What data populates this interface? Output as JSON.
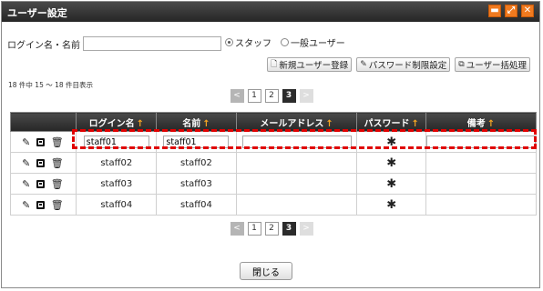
{
  "window": {
    "title": "ユーザー設定"
  },
  "search": {
    "label": "ログイン名・名前",
    "value": "",
    "placeholder": ""
  },
  "radio": {
    "staff_label": "スタッフ",
    "general_label": "一般ユーザー",
    "selected": "staff"
  },
  "actions": {
    "new_user": "新規ユーザー登録",
    "password_limit": "パスワード制限設定",
    "bulk": "ユーザー括処理"
  },
  "count_text": "18 件中 15 ～ 18 件目表示",
  "pager": {
    "pages": [
      "1",
      "2",
      "3"
    ],
    "current": "3"
  },
  "table": {
    "headers": [
      "ログイン名",
      "名前",
      "メールアドレス",
      "パスワード",
      "備考"
    ],
    "sort_arrow": "↑",
    "rows": [
      {
        "login": "staff01",
        "name": "staff01",
        "email": "",
        "note": "",
        "editing": true
      },
      {
        "login": "staff02",
        "name": "staff02",
        "email": "",
        "note": ""
      },
      {
        "login": "staff03",
        "name": "staff03",
        "email": "",
        "note": ""
      },
      {
        "login": "staff04",
        "name": "staff04",
        "email": "",
        "note": ""
      }
    ]
  },
  "close_label": "閉じる",
  "colors": {
    "header": "#262626",
    "accent": "#f07a1f",
    "highlight": "#e00000",
    "sort_arrow": "#f5a623"
  }
}
